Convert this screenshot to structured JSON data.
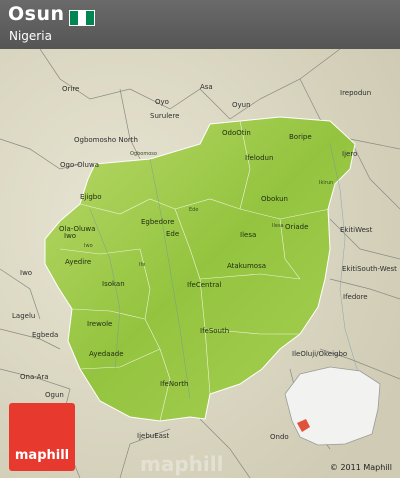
{
  "header": {
    "title": "Osun",
    "subtitle": "Nigeria",
    "flag_colors": [
      "#008751",
      "#ffffff",
      "#008751"
    ]
  },
  "colors": {
    "background": "#d9d7c4",
    "region_fill": "#9fcb4a",
    "region_light": "#c5e07a",
    "inset_highlight": "#e0533a",
    "logo": "#e8392e"
  },
  "outside_places": [
    {
      "id": "orire",
      "text": "Orire"
    },
    {
      "id": "ogbomoso",
      "text": "Ogbomosho North"
    },
    {
      "id": "oyo",
      "text": "Oyo"
    },
    {
      "id": "ogo-oluwa",
      "text": "Ogo-Oluwa"
    },
    {
      "id": "surulere",
      "text": "Surulere"
    },
    {
      "id": "asa",
      "text": "Asa"
    },
    {
      "id": "oyun",
      "text": "Oyun"
    },
    {
      "id": "irepodun",
      "text": "Irepodun"
    },
    {
      "id": "iwo-out",
      "text": "Iwo"
    },
    {
      "id": "lagelu",
      "text": "Lagelu"
    },
    {
      "id": "egbeda",
      "text": "Egbeda"
    },
    {
      "id": "ona-ara",
      "text": "Ona-Ara"
    },
    {
      "id": "ogun",
      "text": "Ogun"
    },
    {
      "id": "ijebu-east",
      "text": "IjebuEast"
    },
    {
      "id": "ekiti-west",
      "text": "EkitiWest"
    },
    {
      "id": "ekiti-southwest",
      "text": "EkitiSouth-West"
    },
    {
      "id": "ife-dore",
      "text": "Ifedore"
    },
    {
      "id": "ileoluji",
      "text": "IleOluji/Okeigbo"
    },
    {
      "id": "ijero",
      "text": "Ijero"
    },
    {
      "id": "ondo",
      "text": "Ondo"
    }
  ],
  "inside_places": [
    {
      "id": "ejigbo",
      "text": "Ejigbo"
    },
    {
      "id": "ola-oluwa",
      "text": "Ola-Oluwa"
    },
    {
      "id": "iwo",
      "text": "Iwo"
    },
    {
      "id": "egbedore",
      "text": "Egbedore"
    },
    {
      "id": "ede",
      "text": "Ede"
    },
    {
      "id": "ayedire",
      "text": "Ayedire"
    },
    {
      "id": "irewole",
      "text": "Irewole"
    },
    {
      "id": "isokan",
      "text": "Isokan"
    },
    {
      "id": "ayedaade",
      "text": "Ayedaade"
    },
    {
      "id": "ife-central",
      "text": "IfeCentral"
    },
    {
      "id": "ife-south",
      "text": "IfeSouth"
    },
    {
      "id": "ife-north",
      "text": "IfeNorth"
    },
    {
      "id": "atakumosa",
      "text": "Atakumosa"
    },
    {
      "id": "ilesa",
      "text": "Ilesa"
    },
    {
      "id": "obokun",
      "text": "Obokun"
    },
    {
      "id": "oriade",
      "text": "Oriade"
    },
    {
      "id": "boripe",
      "text": "Boripe"
    },
    {
      "id": "odo-otin",
      "text": "OdoOtin"
    },
    {
      "id": "ifelodun",
      "text": "Ifelodun"
    }
  ],
  "small_places": [
    {
      "id": "sm-ogbomosho",
      "text": "Ogbomoso"
    },
    {
      "id": "sm-ede",
      "text": "Ede"
    },
    {
      "id": "sm-ikirun",
      "text": "Ikirun"
    },
    {
      "id": "sm-iwo",
      "text": "Iwo"
    },
    {
      "id": "sm-ife",
      "text": "Ife"
    },
    {
      "id": "sm-ilesa",
      "text": "Ilesa"
    }
  ],
  "branding": {
    "logo_text": "maphill",
    "copyright": "© 2011 Maphill",
    "watermark": "maphill"
  }
}
